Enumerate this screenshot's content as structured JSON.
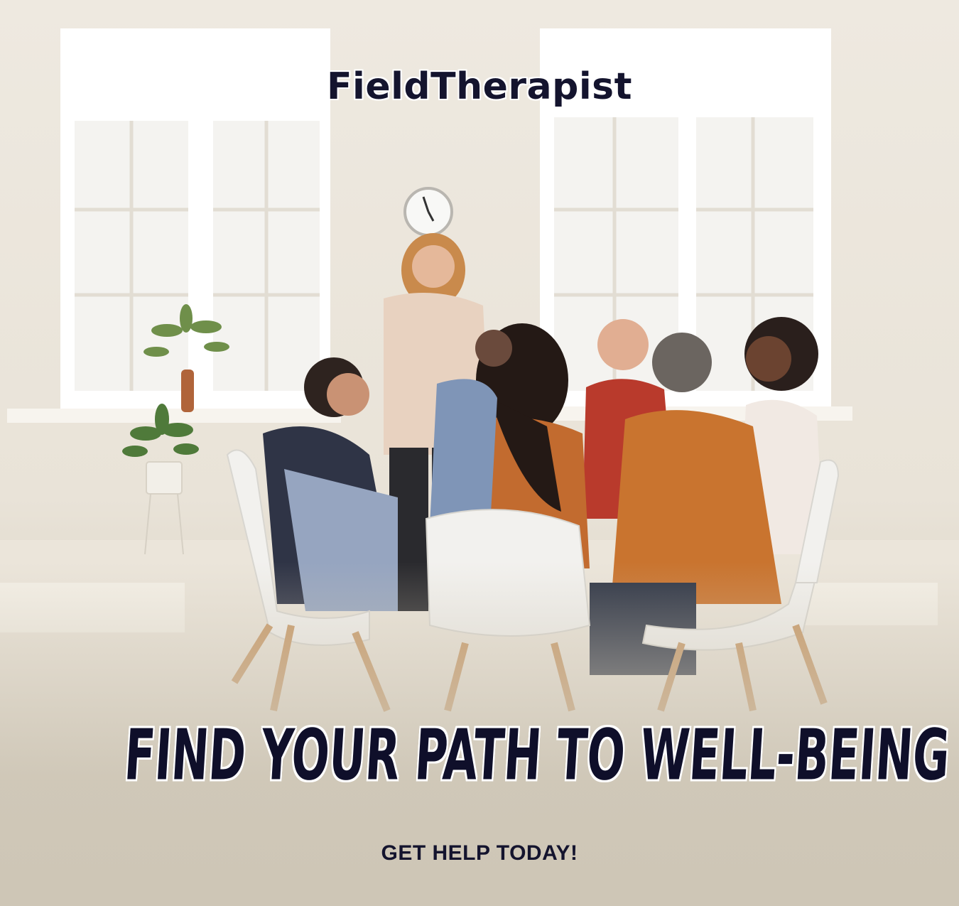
{
  "brand": {
    "name": "FieldTherapist"
  },
  "headline": {
    "text": "FIND YOUR PATH TO WELL-BEING"
  },
  "cta": {
    "text": "GET HELP TODAY!"
  },
  "colors": {
    "text_dark": "#14142e",
    "background_beige": "#d7cfbf",
    "wall": "#eee9e0"
  },
  "icons": [
    "wall-clock-icon",
    "plant-icon"
  ]
}
